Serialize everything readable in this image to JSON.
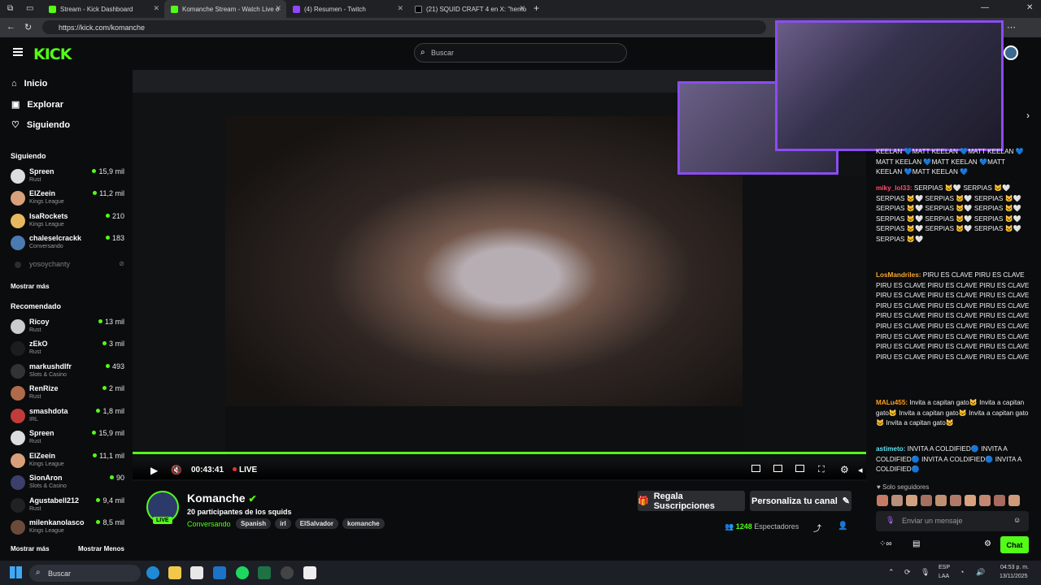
{
  "browser": {
    "tabs": [
      {
        "label": "Stream - Kick Dashboard",
        "favicon": "kick-icon"
      },
      {
        "label": "Komanche Stream - Watch Live o",
        "favicon": "kick-icon",
        "active": true
      },
      {
        "label": "(4) Resumen - Twitch",
        "favicon": "twitch-icon"
      },
      {
        "label": "(21) SQUID CRAFT 4 en X: \"hemo",
        "favicon": "x-icon"
      }
    ],
    "url": "https://kick.com/komanche"
  },
  "kick": {
    "logo": "KICK",
    "search_placeholder": "Buscar",
    "nav": [
      {
        "label": "Inicio",
        "icon": "home-icon"
      },
      {
        "label": "Explorar",
        "icon": "compass-icon"
      },
      {
        "label": "Siguiendo",
        "icon": "heart-icon"
      }
    ],
    "following_title": "Siguiendo",
    "following": [
      {
        "name": "Spreen",
        "category": "Rust",
        "viewers": "15,9 mil"
      },
      {
        "name": "ElZeein",
        "category": "Kings League",
        "viewers": "11,2 mil"
      },
      {
        "name": "IsaRockets",
        "category": "Kings League",
        "viewers": "210"
      },
      {
        "name": "chaleselcrackk",
        "category": "Conversando",
        "viewers": "183"
      },
      {
        "name": "yosoychanty",
        "category": "",
        "viewers": ""
      }
    ],
    "show_more": "Mostrar más",
    "recommended_title": "Recomendado",
    "recommended": [
      {
        "name": "Ricoy",
        "category": "Rust",
        "viewers": "13 mil"
      },
      {
        "name": "zEkO",
        "category": "Rust",
        "viewers": "3 mil"
      },
      {
        "name": "markushdlfr",
        "category": "Slots & Casino",
        "viewers": "493"
      },
      {
        "name": "RenRize",
        "category": "Rust",
        "viewers": "2 mil"
      },
      {
        "name": "smashdota",
        "category": "IRL",
        "viewers": "1,8 mil"
      },
      {
        "name": "Spreen",
        "category": "Rust",
        "viewers": "15,9 mil"
      },
      {
        "name": "ElZeein",
        "category": "Kings League",
        "viewers": "11,1 mil"
      },
      {
        "name": "SionAron",
        "category": "Slots & Casino",
        "viewers": "90"
      },
      {
        "name": "Agustabell212",
        "category": "Rust",
        "viewers": "9,4 mil"
      },
      {
        "name": "milenkanolasco",
        "category": "Kings League",
        "viewers": "8,5 mil"
      }
    ],
    "show_more_bottom": "Mostrar más",
    "show_less": "Mostrar Menos"
  },
  "player": {
    "time": "00:43:41",
    "live": "LIVE"
  },
  "channel": {
    "name": "Komanche",
    "title": "20 participantes de los squids",
    "category": "Conversando",
    "tags": [
      "Spanish",
      "irl",
      "ElSalvador",
      "komanche"
    ],
    "live_badge": "LIVE",
    "subs_button": "Regala Suscripciones",
    "customize_button": "Personaliza tu canal",
    "viewers": "1248",
    "viewers_label": "Espectadores"
  },
  "chat": {
    "messages": [
      {
        "user": "",
        "user_color": "#ffffff",
        "text": "KEELAN 💙MATT KEELAN 💙MATT KEELAN 💙MATT KEELAN 💙MATT KEELAN 💙MATT KEELAN 💙MATT KEELAN 💙"
      },
      {
        "user": "miky_lol33:",
        "user_color": "#ff4d6d",
        "text": " SERPIAS 🐱🤍 SERPIAS 🐱🤍 SERPIAS 🐱🤍 SERPIAS 🐱🤍 SERPIAS 🐱🤍 SERPIAS 🐱🤍 SERPIAS 🐱🤍 SERPIAS 🐱🤍 SERPIAS 🐱🤍 SERPIAS 🐱🤍 SERPIAS 🐱🤍 SERPIAS 🐱🤍 SERPIAS 🐱🤍 SERPIAS 🐱🤍 SERPIAS 🐱🤍"
      },
      {
        "user": "LosMandriles:",
        "user_color": "#f7a733",
        "text": " PIRU ES CLAVE PIRU ES CLAVE PIRU ES CLAVE PIRU ES CLAVE PIRU ES CLAVE PIRU ES CLAVE PIRU ES CLAVE PIRU ES CLAVE PIRU ES CLAVE PIRU ES CLAVE PIRU ES CLAVE PIRU ES CLAVE PIRU ES CLAVE PIRU ES CLAVE PIRU ES CLAVE PIRU ES CLAVE PIRU ES CLAVE PIRU ES CLAVE PIRU ES CLAVE PIRU ES CLAVE PIRU ES CLAVE PIRU ES CLAVE PIRU ES CLAVE PIRU ES CLAVE PIRU ES CLAVE PIRU ES CLAVE"
      },
      {
        "user": "MALu455:",
        "user_color": "#ff9f1c",
        "text": " Invita a capitan gato🐱 Invita a capitan gato🐱 Invita a capitan gato🐱 Invita a capitan gato🐱 Invita a capitan gato🐱"
      },
      {
        "user": "astimeto:",
        "user_color": "#5ee0f2",
        "text": " INVITA A COLDIFIED🔵 INVITA A COLDIFIED🔵 INVITA A COLDIFIED🔵 INVITA A COLDIFIED🔵"
      }
    ],
    "followers_only": "Solo seguidores",
    "input_placeholder": "Enviar un mensaje",
    "send_button": "Chat"
  },
  "taskbar": {
    "search": "Buscar",
    "lang_top": "ESP",
    "lang_bottom": "LAA",
    "time": "04:53 p. m.",
    "date": "13/11/2025"
  },
  "colors": {
    "accent": "#53fc18",
    "purple": "#8b4cf2"
  }
}
